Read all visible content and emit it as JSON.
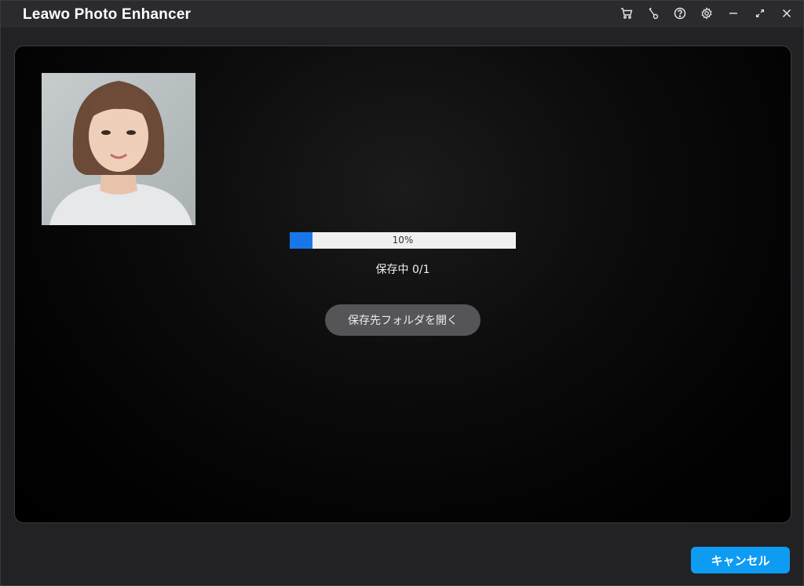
{
  "window": {
    "title": "Leawo Photo Enhancer"
  },
  "titlebar_icons": [
    "cart-icon",
    "key-icon",
    "help-icon",
    "settings-icon",
    "minimize-icon",
    "restore-icon",
    "close-icon"
  ],
  "progress": {
    "percent": 10,
    "label": "10%"
  },
  "status": {
    "text": "保存中 0/1"
  },
  "actions": {
    "open_folder_label": "保存先フォルダを開く",
    "cancel_label": "キャンセル"
  },
  "colors": {
    "accent": "#0e9bf2",
    "progress_fill": "#1877e8",
    "background": "#222225"
  }
}
